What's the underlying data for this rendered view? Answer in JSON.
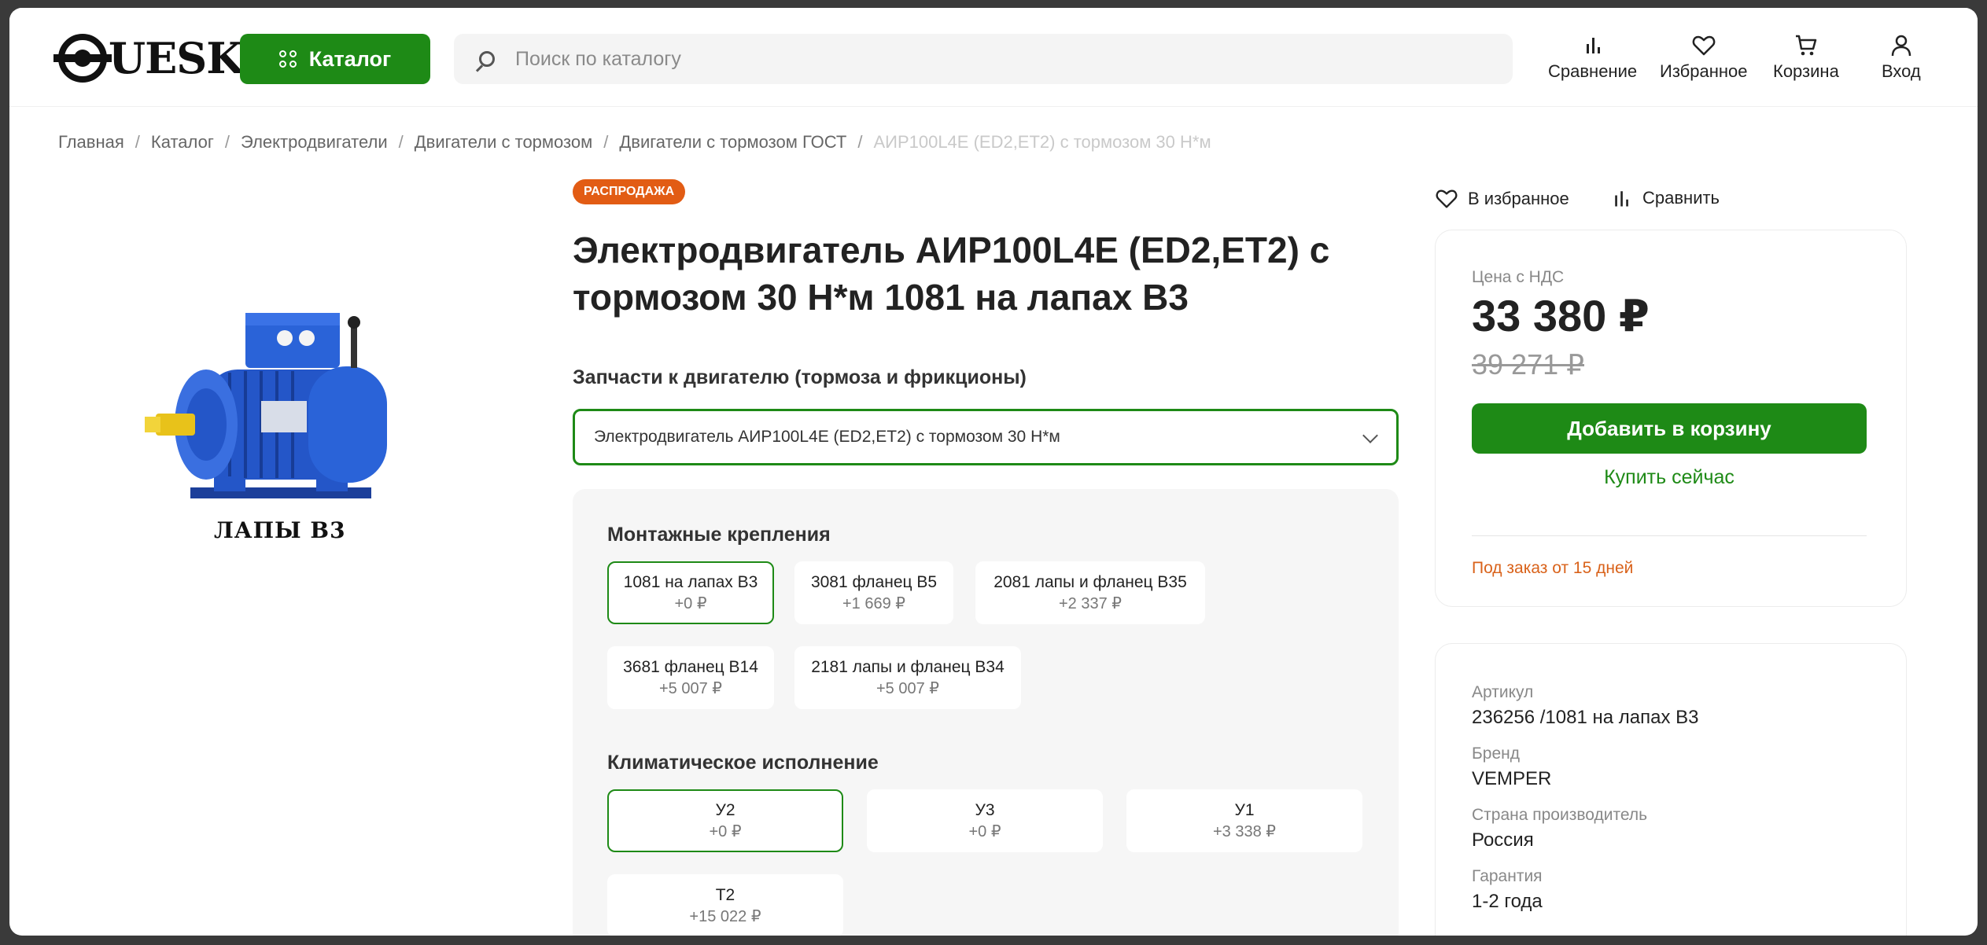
{
  "header": {
    "logo_text": "UESK",
    "catalog_label": "Каталог",
    "search_placeholder": "Поиск по каталогу",
    "nav": {
      "compare": "Сравнение",
      "favorites": "Избранное",
      "cart": "Корзина",
      "login": "Вход"
    }
  },
  "breadcrumb": [
    "Главная",
    "Каталог",
    "Электродвигатели",
    "Двигатели с тормозом",
    "Двигатели с тормозом ГОСТ",
    "АИР100L4E (ED2,ET2) с тормозом 30 Н*м"
  ],
  "product": {
    "image_caption": "ЛАПЫ B3",
    "badge": "РАСПРОДАЖА",
    "title": "Электродвигатель АИР100L4E (ED2,ET2) с тормозом 30 Н*м 1081 на лапах B3",
    "parts_label": "Запчасти к двигателю (тормоза и фрикционы)",
    "parts_selected": "Электродвигатель АИР100L4E (ED2,ET2) с тормозом 30 Н*м"
  },
  "options": {
    "mounting": {
      "title": "Монтажные крепления",
      "items": [
        {
          "name": "1081 на лапах B3",
          "price": "+0 ₽"
        },
        {
          "name": "3081 фланец B5",
          "price": "+1 669 ₽"
        },
        {
          "name": "2081 лапы и фланец B35",
          "price": "+2 337 ₽"
        },
        {
          "name": "3681 фланец B14",
          "price": "+5 007 ₽"
        },
        {
          "name": "2181 лапы и фланец B34",
          "price": "+5 007 ₽"
        }
      ]
    },
    "climate": {
      "title": "Климатическое исполнение",
      "items": [
        {
          "name": "У2",
          "price": "+0 ₽"
        },
        {
          "name": "У3",
          "price": "+0 ₽"
        },
        {
          "name": "У1",
          "price": "+3 338 ₽"
        },
        {
          "name": "Т2",
          "price": "+15 022 ₽"
        }
      ]
    }
  },
  "actions": {
    "favorite": "В избранное",
    "compare": "Сравнить"
  },
  "price_card": {
    "label": "Цена с НДС",
    "price": "33 380 ₽",
    "old_price": "39 271 ₽",
    "add_to_cart": "Добавить в корзину",
    "buy_now": "Купить сейчас",
    "order_note": "Под заказ от 15 дней"
  },
  "specs": [
    {
      "label": "Артикул",
      "value": "236256 /1081 на лапах B3"
    },
    {
      "label": "Бренд",
      "value": "VEMPER"
    },
    {
      "label": "Страна производитель",
      "value": "Россия"
    },
    {
      "label": "Гарантия",
      "value": "1-2 года"
    }
  ],
  "colors": {
    "accent": "#1e8a16",
    "badge": "#e25c14",
    "note": "#d9621a",
    "motor_blue": "#2456c8"
  }
}
